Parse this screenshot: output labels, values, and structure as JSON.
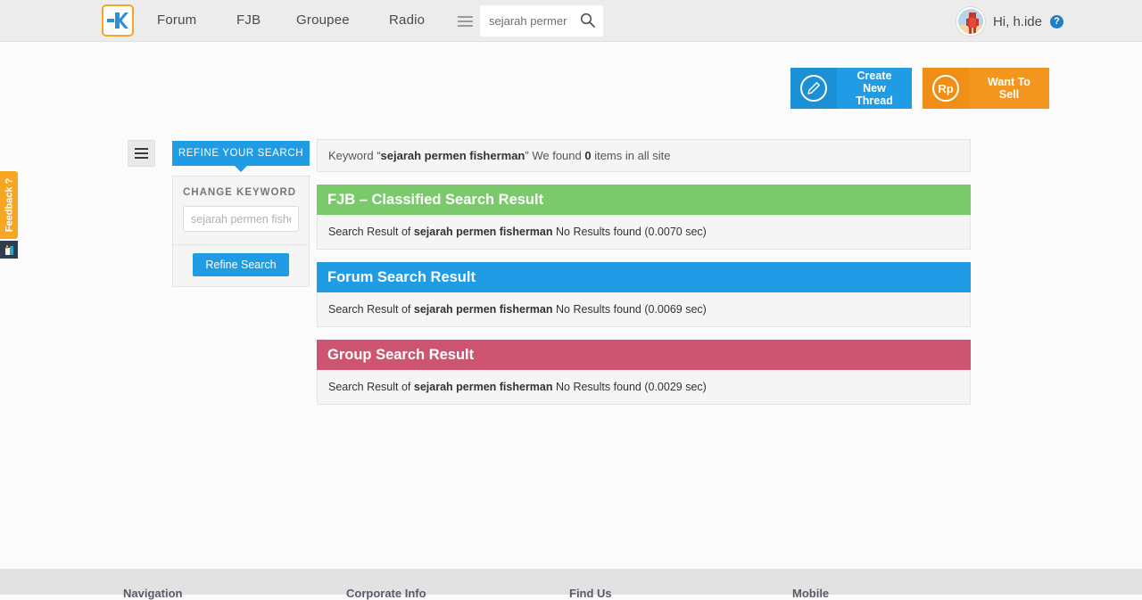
{
  "header": {
    "logo_alt": "kaskus-logo",
    "nav": [
      {
        "label": "Forum"
      },
      {
        "label": "FJB"
      },
      {
        "label": "Groupee"
      },
      {
        "label": "Radio"
      }
    ],
    "search": {
      "value": "sejarah permer",
      "placeholder": "sejarah permer",
      "menu_icon": "hamburger-icon",
      "submit_icon": "search-icon"
    },
    "account": {
      "greeting": "Hi, h.ide",
      "help_label": "?",
      "avatar_alt": "user-avatar"
    },
    "colors": {
      "bar_bg": "#ececec",
      "logo_border": "#f5a623"
    }
  },
  "actions": [
    {
      "label": "Create New Thread",
      "icon": "pencil-icon",
      "color": "#1f9ce4"
    },
    {
      "label": "Want To Sell",
      "icon": "rp-currency-icon",
      "color": "#f29620"
    }
  ],
  "feedback": {
    "label": "Feedback ?",
    "color": "#f5a623"
  },
  "sidebar": {
    "toggle_icon": "hamburger-icon",
    "tab_label": "REFINE YOUR SEARCH",
    "section_title": "CHANGE KEYWORD",
    "keyword_value": "",
    "keyword_placeholder": "sejarah permen fisherman",
    "button_label": "Refine Search",
    "accent": "#1f9ce4"
  },
  "results": {
    "summary": {
      "prefix": "Keyword “",
      "keyword": "sejarah permen fisherman",
      "middle": "” We found ",
      "count": "0",
      "suffix": " items in all site"
    },
    "blocks": [
      {
        "title": "FJB – Classified Search Result",
        "color": "#7ac96b",
        "body_prefix": "Search Result of ",
        "keyword": "sejarah permen fisherman",
        "body_suffix": "  No Results found (0.0070 sec)"
      },
      {
        "title": "Forum Search Result",
        "color": "#1f9ce4",
        "body_prefix": "Search Result of ",
        "keyword": "sejarah permen fisherman",
        "body_suffix": " No Results found (0.0069 sec)"
      },
      {
        "title": "Group Search Result",
        "color": "#cd5571",
        "body_prefix": "Search Result of ",
        "keyword": "sejarah permen fisherman",
        "body_suffix": " No Results found (0.0029 sec)"
      }
    ]
  },
  "footer": {
    "columns": [
      {
        "heading": "Navigation"
      },
      {
        "heading": "Corporate Info"
      },
      {
        "heading": "Find Us"
      },
      {
        "heading": "Mobile"
      }
    ]
  }
}
